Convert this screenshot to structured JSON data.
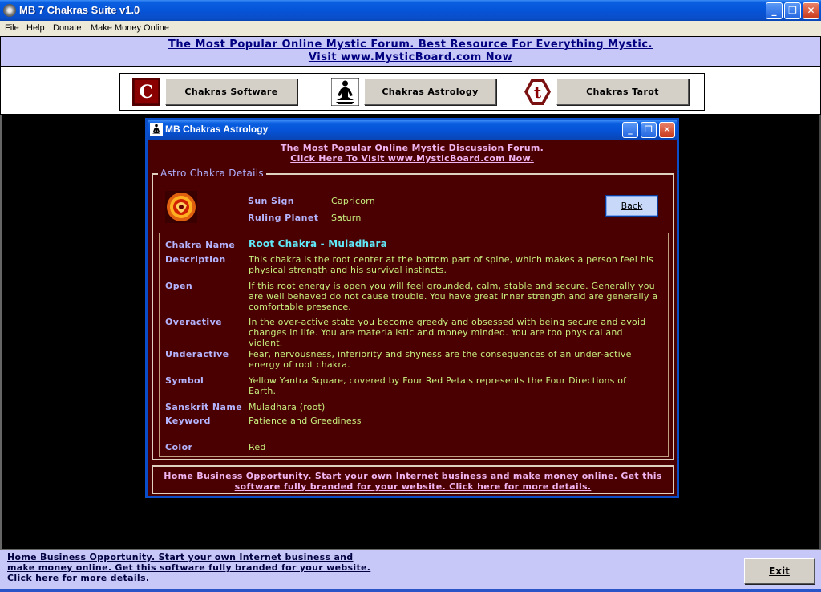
{
  "window": {
    "title": "MB 7 Chakras Suite v1.0",
    "minimize": "_",
    "restore": "❐",
    "close": "✕"
  },
  "menu": {
    "file": "File",
    "help": "Help",
    "donate": "Donate",
    "money": "Make Money Online"
  },
  "top_banner": {
    "text": "The Most Popular Online Mystic Forum. Best Resource For Everything Mystic. Visit www.MysticBoard.com Now"
  },
  "toolbar": {
    "software_label": "Chakras Software",
    "astrology_label": "Chakras Astrology",
    "tarot_label": "Chakras Tarot",
    "software_icon_letter": "C",
    "tarot_icon_letter": "t"
  },
  "child_window": {
    "title": "MB Chakras Astrology",
    "forum_line1": "The Most Popular Online Mystic Discussion Forum.",
    "forum_line2": "Click Here To Visit www.MysticBoard.com Now.",
    "group_title": "Astro Chakra Details",
    "sun_sign_label": "Sun Sign",
    "sun_sign_value": "Capricorn",
    "ruling_planet_label": "Ruling Planet",
    "ruling_planet_value": "Saturn",
    "back_label": "Back",
    "details": {
      "chakra_name_label": "Chakra Name",
      "chakra_name_value": "Root Chakra - Muladhara",
      "description_label": "Description",
      "description_value": "This chakra is the root center at the bottom part of spine, which makes a person feel his physical strength and his survival instincts.",
      "open_label": "Open",
      "open_value": "If this root energy is open you will feel grounded, calm, stable and secure. Generally you are well behaved do not cause trouble. You have great inner strength and are generally a comfortable presence.",
      "overactive_label": "Overactive",
      "overactive_value": "In the over-active state you become greedy and obsessed with being secure and avoid changes in life. You are materialistic and money minded. You are too physical and violent.",
      "underactive_label": "Underactive",
      "underactive_value": "Fear, nervousness, inferiority and shyness are the consequences of an under-active energy of root chakra.",
      "symbol_label": "Symbol",
      "symbol_value": "Yellow Yantra Square, covered by Four Red Petals represents the Four Directions of Earth.",
      "sanskrit_label": "Sanskrit Name",
      "sanskrit_value": "Muladhara (root)",
      "keyword_label": "Keyword",
      "keyword_value": "Patience and Greediness",
      "color_label": "Color",
      "color_value": "Red"
    },
    "bottom_link": "Home Business Opportunity. Start your own Internet business and make money online. Get this software fully branded for your website. Click here for more details."
  },
  "bottom_bar": {
    "promo": "Home Business Opportunity. Start your own Internet business and make money online. Get this software fully branded for your website. Click here for more details.",
    "exit_label": "Exit"
  },
  "colors": {
    "titlebar_blue": "#0654d8",
    "panel_maroon": "#4a0000",
    "banner_lavender": "#c8c8f8",
    "label_blue": "#b4b4ff",
    "value_green": "#c8f080",
    "link_pink": "#f0b4f0",
    "name_cyan": "#60e8f8"
  }
}
